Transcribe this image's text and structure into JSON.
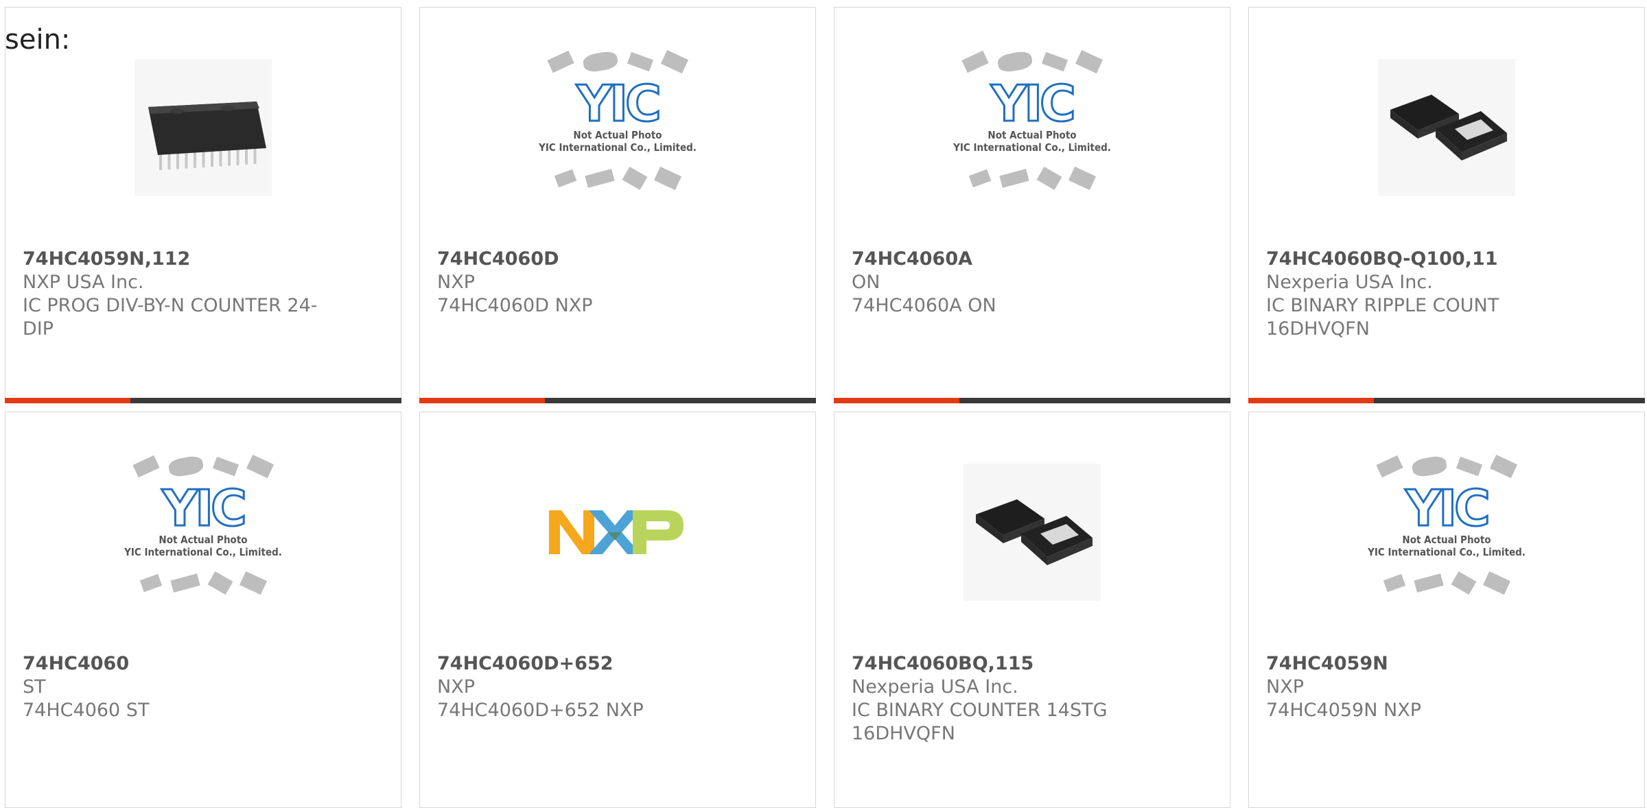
{
  "heading": "sein:",
  "colors": {
    "accent": "#e33a14",
    "bar": "#3a3a3a",
    "border": "#d7d7d7"
  },
  "placeholder": {
    "logo": "YIC",
    "line1": "Not Actual Photo",
    "line2": "YIC International Co., Limited."
  },
  "nxp_logo": "NXP",
  "products": [
    {
      "part": "74HC4059N,112",
      "manufacturer": "NXP USA Inc.",
      "description": "IC PROG DIV-BY-N COUNTER 24-DIP",
      "image": "dip-24-chip-icon"
    },
    {
      "part": "74HC4060D",
      "manufacturer": "NXP",
      "description": "74HC4060D NXP",
      "image": "yic-placeholder"
    },
    {
      "part": "74HC4060A",
      "manufacturer": "ON",
      "description": "74HC4060A ON",
      "image": "yic-placeholder"
    },
    {
      "part": "74HC4060BQ-Q100,11",
      "manufacturer": "Nexperia USA Inc.",
      "description": "IC BINARY RIPPLE COUNT 16DHVQFN",
      "image": "qfn-chip-icon"
    },
    {
      "part": "74HC4060",
      "manufacturer": "ST",
      "description": "74HC4060 ST",
      "image": "yic-placeholder"
    },
    {
      "part": "74HC4060D+652",
      "manufacturer": "NXP",
      "description": "74HC4060D+652 NXP",
      "image": "nxp-logo"
    },
    {
      "part": "74HC4060BQ,115",
      "manufacturer": "Nexperia USA Inc.",
      "description": "IC BINARY COUNTER 14STG 16DHVQFN",
      "image": "qfn-chip-icon"
    },
    {
      "part": "74HC4059N",
      "manufacturer": "NXP",
      "description": "74HC4059N NXP",
      "image": "yic-placeholder"
    }
  ]
}
